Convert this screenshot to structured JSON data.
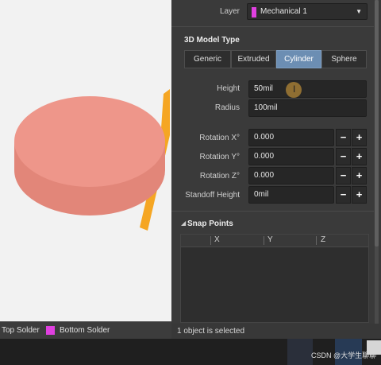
{
  "colors": {
    "layer_swatch": "#e040e0",
    "cylinder": "#ee968a",
    "cylinder_side": "#e28679",
    "rod": "#f5a623",
    "active_tab": "#6c8eb3"
  },
  "properties": {
    "layer": {
      "label": "Layer",
      "value": "Mechanical 1"
    },
    "model_type": {
      "title": "3D Model Type",
      "options": [
        "Generic",
        "Extruded",
        "Cylinder",
        "Sphere"
      ],
      "selected": "Cylinder"
    },
    "height": {
      "label": "Height",
      "value": "50mil"
    },
    "radius": {
      "label": "Radius",
      "value": "100mil"
    },
    "rotation_x": {
      "label": "Rotation X°",
      "value": "0.000"
    },
    "rotation_y": {
      "label": "Rotation Y°",
      "value": "0.000"
    },
    "rotation_z": {
      "label": "Rotation Z°",
      "value": "0.000"
    },
    "standoff": {
      "label": "Standoff Height",
      "value": "0mil"
    },
    "minus": "−",
    "plus": "+"
  },
  "snap_points": {
    "title": "Snap Points",
    "columns": [
      "X",
      "Y",
      "Z"
    ]
  },
  "status": "1 object is selected",
  "layer_tabs": [
    {
      "label": "Top Solder",
      "color": "#ff7ad9"
    },
    {
      "label": "Bottom Solder",
      "color": "#e040e0"
    }
  ],
  "taskbar": {
    "watermark": "CSDN @大学生聊聊"
  }
}
